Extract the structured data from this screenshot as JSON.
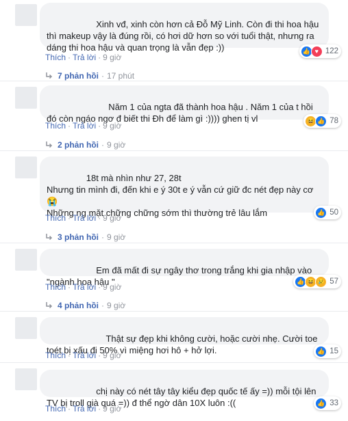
{
  "comments": [
    {
      "text": "                Xinh vđ, xinh còn hơn cả Đỗ Mỹ Linh. Còn đi thi hoa hậu thì makeup vậy là đúng rồi, có hơi dữ hơn so với tuổi thật, nhưng ra dáng thi hoa hậu và quan trọng là vẫn đẹp :))",
      "like": "Thích",
      "reply": "Trả lời",
      "time": "9 giờ",
      "reactions": [
        "like-icon",
        "love-icon"
      ],
      "count": "122",
      "replies_label": "7 phản hồi",
      "replies_time": "17 phút"
    },
    {
      "text": "                     Năm 1 của ngta đã thành hoa hậu . Năm 1 của t hồi đó còn ngáo ngơ đ biết thi Đh để làm gì :)))) ghen tị vl",
      "like": "Thích",
      "reply": "Trả lời",
      "time": "9 giờ",
      "reactions": [
        "haha-icon",
        "like-icon"
      ],
      "count": "78",
      "replies_label": "2 phản hồi",
      "replies_time": "9 giờ"
    },
    {
      "text": "            18t mà nhìn như 27, 28t\nNhưng tin mình đi, đến khi e ý 30t e ý vẫn cứ giữ đc nét đẹp này cơ 😭\nNhững ng mặt chững chững sớm thì thường trẻ lâu lắm",
      "like": "Thích",
      "reply": "Trả lời",
      "time": "9 giờ",
      "reactions": [
        "like-icon"
      ],
      "count": "50",
      "replies_label": "3 phản hồi",
      "replies_time": "9 giờ"
    },
    {
      "text": "                Em đã mất đi sự ngây thơ trong trắng khi gia nhập vào \"ngành hoa hậu \"",
      "like": "Thích",
      "reply": "Trả lời",
      "time": "9 giờ",
      "reactions": [
        "like-icon",
        "haha-icon",
        "sad-icon"
      ],
      "count": "57",
      "replies_label": "4 phản hồi",
      "replies_time": "9 giờ"
    },
    {
      "text": "                    Thật sự đẹp khi không cười, hoặc cười nhẹ. Cười toe toét bị xấu đi 50% vì miệng hơi hô + hở lợi.",
      "like": "Thích",
      "reply": "Trả lời",
      "time": "9 giờ",
      "reactions": [
        "like-icon"
      ],
      "count": "15",
      "replies_label": "",
      "replies_time": ""
    },
    {
      "text": "                chị này có nét tây tây kiểu đẹp quốc tế ấy =)) mỗi tội lên TV bị troll già quá =)) đ thể ngờ dân 10X luôn :((",
      "like": "Thích",
      "reply": "Trả lời",
      "time": "9 giờ",
      "reactions": [
        "like-icon"
      ],
      "count": "33",
      "replies_label": "",
      "replies_time": ""
    }
  ]
}
